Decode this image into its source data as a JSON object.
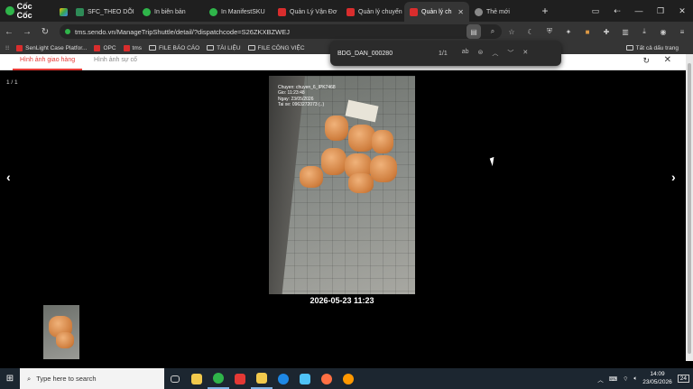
{
  "browser": {
    "brand": "Cốc Cốc",
    "tabs": [
      {
        "title": "SFC_THEO DÕI",
        "color": "#2e8b57"
      },
      {
        "title": "In biên bản",
        "color": "#2fb54a"
      },
      {
        "title": "In ManifestSKU",
        "color": "#2fb54a"
      },
      {
        "title": "Quản Lý Vận Đơ",
        "color": "#d92d2d"
      },
      {
        "title": "Quản lý chuyến",
        "color": "#d92d2d"
      },
      {
        "title": "Quản lý ch",
        "color": "#d92d2d",
        "active": true
      },
      {
        "title": "Thẻ mới",
        "color": "#aaaaaa"
      }
    ],
    "url": "tms.sendo.vn/ManageTripShuttle/detail/?dispatchcode=S26ZKXBZWEJ",
    "bookmarks": [
      {
        "label": "SenLight Case Platfor...",
        "type": "red"
      },
      {
        "label": "OPC",
        "type": "red"
      },
      {
        "label": "tms",
        "type": "red"
      },
      {
        "label": "FILE BÁO CÁO",
        "type": "folder"
      },
      {
        "label": "TÀI LIỆU",
        "type": "folder"
      },
      {
        "label": "FILE CÔNG VIỆC",
        "type": "folder"
      }
    ],
    "all_bookmarks": "Tất cả dấu trang"
  },
  "find": {
    "term": "BDG_DAN_000280",
    "count": "1/1"
  },
  "page": {
    "tab_active": "Hình ảnh giao hàng",
    "tab_second": "Hình ảnh sự cố",
    "counter": "1 / 1",
    "photo_watermark": [
      "Chuyen: chuyen_6_IPK7468",
      "Gio: 11:23:48",
      "Ngay: 23/05/2026",
      "Tai xe: 0963272073 (..)"
    ],
    "caption": "2026-05-23 11:23"
  },
  "taskbar": {
    "search_placeholder": "Type here to search",
    "time": "14:09",
    "date": "23/05/2026",
    "notifications": "24"
  }
}
